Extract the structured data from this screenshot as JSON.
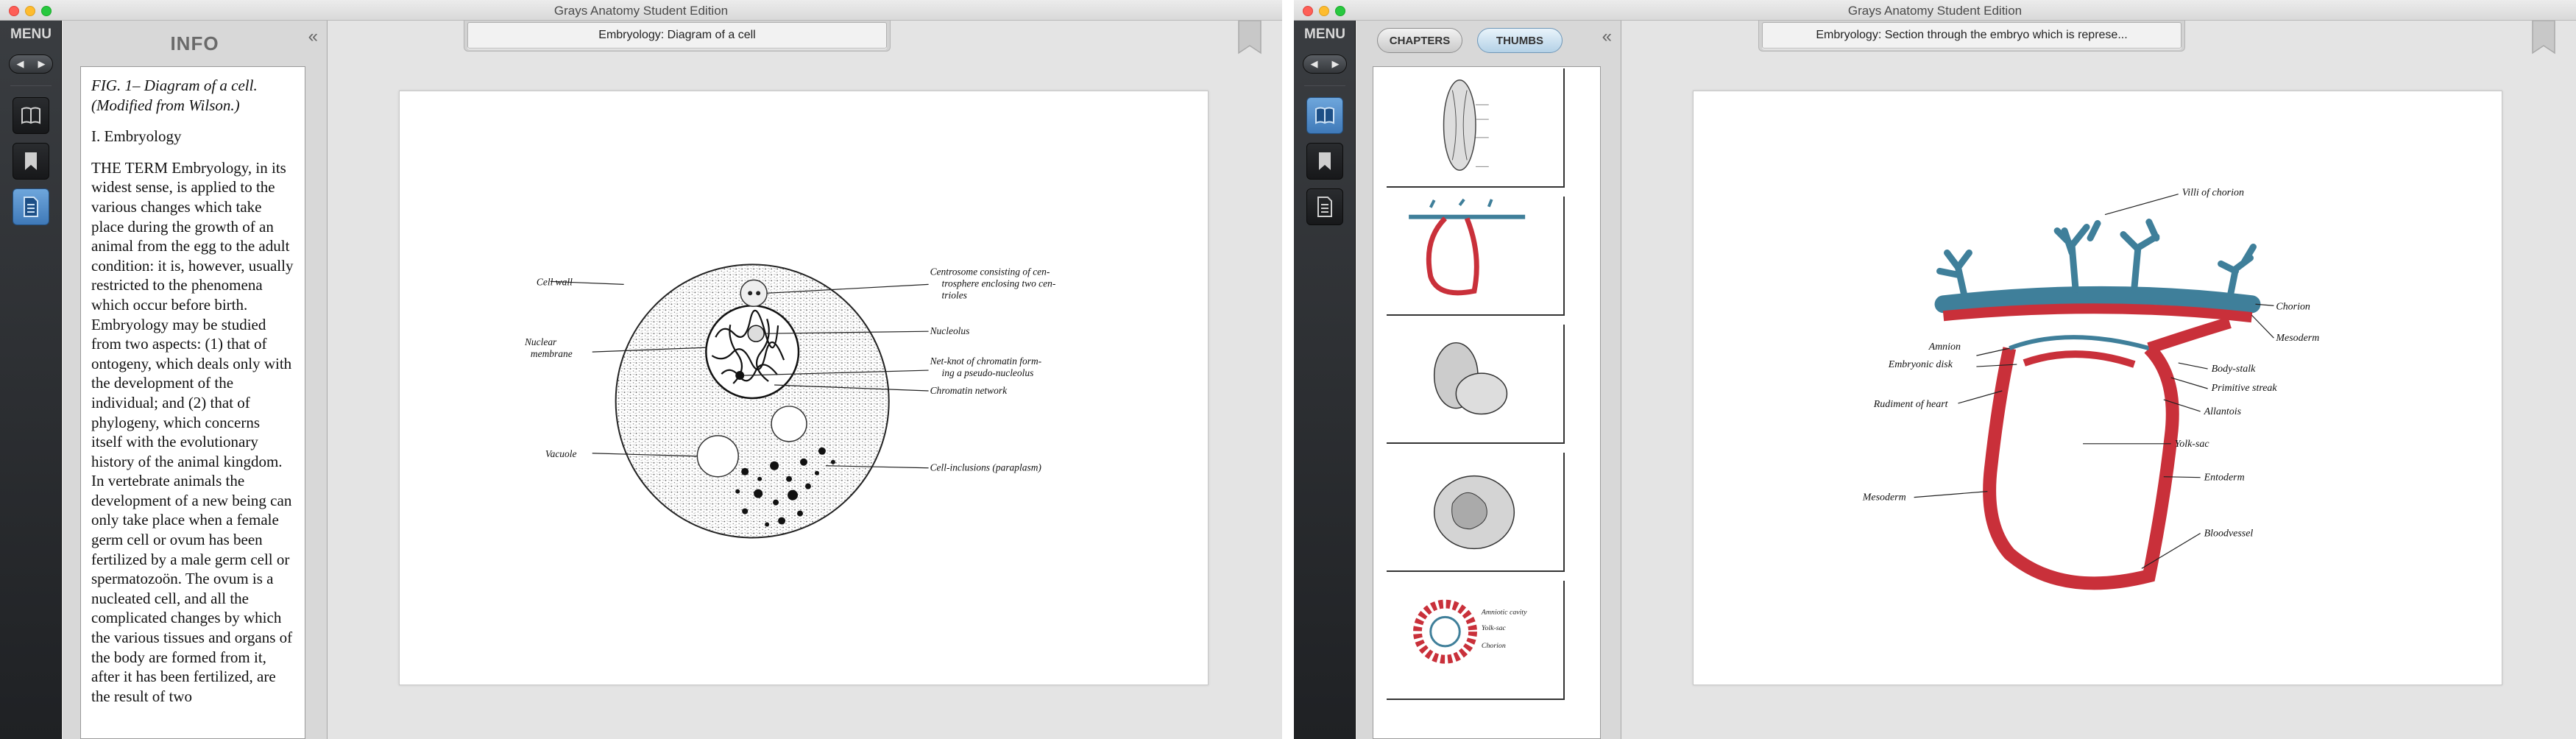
{
  "window1": {
    "title": "Grays Anatomy Student Edition",
    "dock": {
      "menu_label": "MENU",
      "nav_prev": "◀",
      "nav_next": "▶"
    },
    "panel": {
      "title": "INFO",
      "collapse": "«",
      "caption_line1": "FIG. 1– Diagram of a cell.",
      "caption_line2": "(Modified from Wilson.)",
      "section": "I. Embryology",
      "body": "THE TERM Embryology, in its widest sense, is applied to the various changes which take place during the growth of an animal from the egg to the adult condition: it is, however, usually restricted to the phenomena which occur before birth. Embryology may be studied from two aspects: (1) that of ontogeny, which deals only with the development of the individual; and (2) that of phylogeny, which concerns itself with the evolutionary history of the animal kingdom. In vertebrate animals the development of a new being can only take place when a female germ cell or ovum has been fertilized by a male germ cell or spermatozoön. The ovum is a nucleated cell, and all the complicated changes by which the various tissues and organs of the body are formed from it, after it has been fertilized, are the result of two"
    },
    "page_title": "Embryology: Diagram of a cell",
    "figure_labels": {
      "cell_wall": "Cell wall",
      "nuclear_membrane_1": "Nuclear",
      "nuclear_membrane_2": "membrane",
      "vacuole": "Vacuole",
      "centrosome_1": "Centrosome consisting of cen-",
      "centrosome_2": "trosphere enclosing two cen-",
      "centrosome_3": "trioles",
      "nucleolus": "Nucleolus",
      "netknot_1": "Net-knot of chromatin form-",
      "netknot_2": "ing a pseudo-nucleolus",
      "chromatin": "Chromatin network",
      "inclusions": "Cell-inclusions (paraplasm)"
    }
  },
  "window2": {
    "title": "Grays Anatomy Student Edition",
    "dock": {
      "menu_label": "MENU",
      "nav_prev": "◀",
      "nav_next": "▶"
    },
    "tabs": [
      {
        "label": "CHAPTERS"
      },
      {
        "label": "THUMBS"
      }
    ],
    "collapse": "«",
    "page_title": "Embryology: Section through the embryo which is represe...",
    "figure_labels": {
      "villi": "Villi of chorion",
      "chorion": "Chorion",
      "mesoderm_r": "Mesoderm",
      "amnion": "Amnion",
      "embryonic_disk": "Embryonic disk",
      "body_stalk": "Body-stalk",
      "primitive_streak": "Primitive streak",
      "rudiment_heart": "Rudiment of heart",
      "allantois": "Allantois",
      "yolk_sac": "Yolk-sac",
      "entoderm": "Entoderm",
      "mesoderm_l": "Mesoderm",
      "bloodvessel": "Bloodvessel"
    },
    "thumb5_labels": {
      "amniotic": "Amniotic cavity",
      "yolk": "Yolk-sac",
      "chorion": "Chorion"
    }
  },
  "colors": {
    "accent_blue": "#4f86c6",
    "embryo_red": "#c9303a",
    "chorion_blue": "#3f7f9a"
  }
}
